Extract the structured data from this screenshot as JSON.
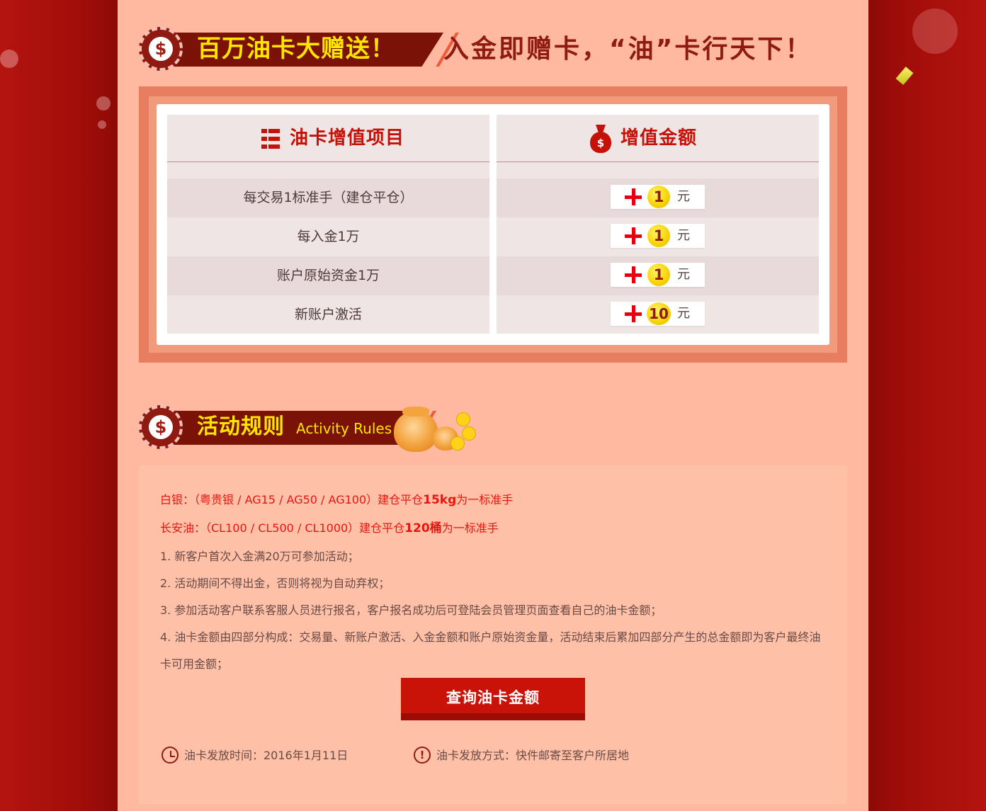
{
  "promo": {
    "title": "百万油卡大赠送！",
    "slogan": "入金即赠卡，“油”卡行天下！"
  },
  "table": {
    "col1_header": "油卡增值项目",
    "col2_header": "增值金额",
    "rows": [
      {
        "item": "每交易1标准手（建仓平仓）",
        "amount": "1",
        "unit": "元"
      },
      {
        "item": "每入金1万",
        "amount": "1",
        "unit": "元"
      },
      {
        "item": "账户原始资金1万",
        "amount": "1",
        "unit": "元"
      },
      {
        "item": "新账户激活",
        "amount": "10",
        "unit": "元"
      }
    ]
  },
  "rules": {
    "title_cn": "活动规则",
    "title_en": "Activity Rules",
    "silver": {
      "prefix": "白银：（粤贵银 / AG15 / AG50 / AG100）建仓平仓",
      "bold": "15kg",
      "suffix": "为一标准手"
    },
    "oil": {
      "prefix": "长安油：（CL100 / CL500 / CL1000）建仓平仓",
      "bold": "120桶",
      "suffix": "为一标准手"
    },
    "items": [
      "1. 新客户首次入金满20万可参加活动；",
      "2. 活动期间不得出金，否则将视为自动弃权；",
      "3. 参加活动客户联系客服人员进行报名，客户报名成功后可登陆会员管理页面查看自己的油卡金额；",
      "4. 油卡金额由四部分构成：交易量、新账户激活、入金金额和账户原始资金量，活动结束后累加四部分产生的总金额即为客户最终油",
      "卡可用金额；"
    ],
    "button_label": "查询油卡金额",
    "issue_time": "油卡发放时间：2016年1月11日",
    "issue_method": "油卡发放方式：快件邮寄至客户所居地"
  },
  "colors": {
    "brand_red": "#c41209",
    "accent_yellow": "#ffe400",
    "panel_bg": "#ffb9a0"
  },
  "icons": [
    "dollar-chip-icon",
    "list-icon",
    "money-bag-icon",
    "plus-icon",
    "coin-icon",
    "clock-icon",
    "exclamation-icon"
  ]
}
